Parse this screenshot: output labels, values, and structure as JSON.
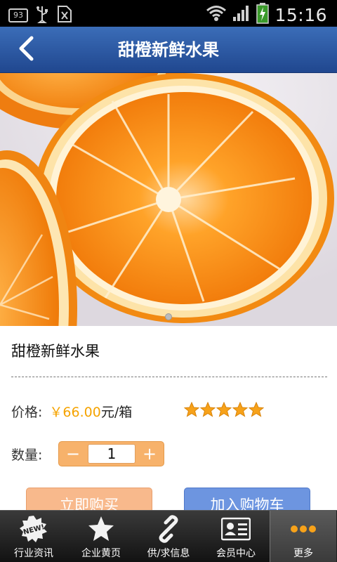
{
  "status_bar": {
    "notification_badge": "93",
    "time": "15:16"
  },
  "header": {
    "title": "甜橙新鲜水果",
    "back_icon": "chevron-left-icon"
  },
  "carousel": {
    "image": "sliced-oranges",
    "page_count": 1,
    "current_page": 1
  },
  "product": {
    "name": "甜橙新鲜水果",
    "price_label": "价格:",
    "price_value": "￥66.00",
    "price_unit": "元/箱",
    "rating": 5,
    "rating_max": 5,
    "quantity_label": "数量:",
    "quantity_value": "1",
    "minus_symbol": "−",
    "plus_symbol": "+"
  },
  "actions": {
    "buy_now": "立即购买",
    "add_to_cart": "加入购物车"
  },
  "bottom_nav": [
    {
      "label": "行业资讯",
      "icon": "new-badge-icon"
    },
    {
      "label": "企业黄页",
      "icon": "star-icon"
    },
    {
      "label": "供/求信息",
      "icon": "link-icon"
    },
    {
      "label": "会员中心",
      "icon": "id-card-icon"
    },
    {
      "label": "更多",
      "icon": "more-dots-icon",
      "active": true
    }
  ],
  "colors": {
    "title_bar": "#2c5aa8",
    "price": "#f5a300",
    "buy_button": "#f8b98c",
    "cart_button": "#6d95e0",
    "stepper": "#f7b26b"
  }
}
